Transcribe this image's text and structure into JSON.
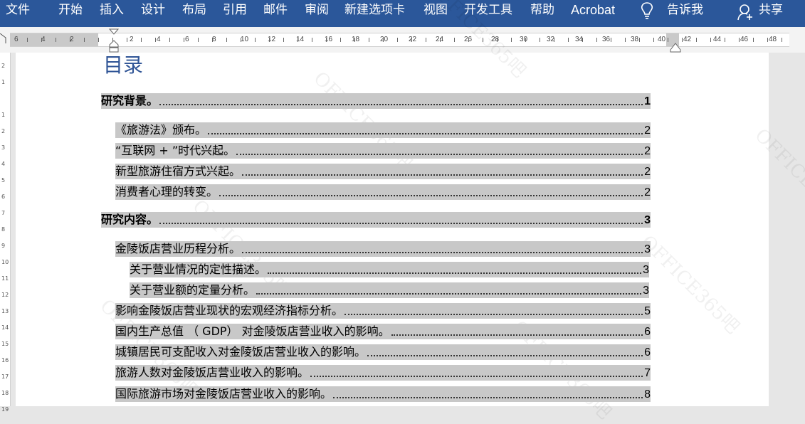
{
  "ribbon": {
    "tabs": [
      "文件",
      "开始",
      "插入",
      "设计",
      "布局",
      "引用",
      "邮件",
      "审阅",
      "新建选项卡",
      "视图",
      "开发工具",
      "帮助",
      "Acrobat"
    ],
    "tell_me": "告诉我",
    "share": "共享"
  },
  "ruler": {
    "labels": [
      "6",
      "4",
      "2",
      "",
      "2",
      "4",
      "6",
      "8",
      "10",
      "12",
      "14",
      "16",
      "18",
      "20",
      "22",
      "24",
      "26",
      "28",
      "30",
      "32",
      "34",
      "36",
      "38",
      "40",
      "42",
      "44",
      "46",
      "48"
    ]
  },
  "vruler": {
    "labels": [
      "2",
      "1",
      "",
      "1",
      "2",
      "3",
      "4",
      "5",
      "6",
      "7",
      "8",
      "9",
      "10",
      "11",
      "12",
      "13",
      "14",
      "15",
      "16",
      "17",
      "18",
      "19"
    ]
  },
  "document": {
    "toc_title": "目录",
    "watermark": "OFFICE365吧",
    "entries": [
      {
        "text": "研究背景。",
        "page": "1",
        "level": 1
      },
      {
        "text": "《旅游法》颁布。",
        "page": "2",
        "level": 2
      },
      {
        "text": "“互联网 + ”时代兴起。",
        "page": "2",
        "level": 2
      },
      {
        "text": "新型旅游住宿方式兴起。",
        "page": "2",
        "level": 2
      },
      {
        "text": "消费者心理的转变。",
        "page": "2",
        "level": 2
      },
      {
        "text": "研究内容。",
        "page": "3",
        "level": 1
      },
      {
        "text": "金陵饭店营业历程分析。",
        "page": "3",
        "level": 2
      },
      {
        "text": "关于营业情况的定性描述。",
        "page": "3",
        "level": 3
      },
      {
        "text": "关于营业额的定量分析。",
        "page": "3",
        "level": 3
      },
      {
        "text": "影响金陵饭店营业现状的宏观经济指标分析。",
        "page": "5",
        "level": 2
      },
      {
        "text": "国内生产总值 （ GDP） 对金陵饭店营业收入的影响。",
        "page": "6",
        "level": 2
      },
      {
        "text": "城镇居民可支配收入对金陵饭店营业收入的影响。",
        "page": "6",
        "level": 2
      },
      {
        "text": "旅游人数对金陵饭店营业收入的影响。",
        "page": "7",
        "level": 2
      },
      {
        "text": "国际旅游市场对金陵饭店营业收入的影响。",
        "page": "8",
        "level": 2
      }
    ]
  }
}
